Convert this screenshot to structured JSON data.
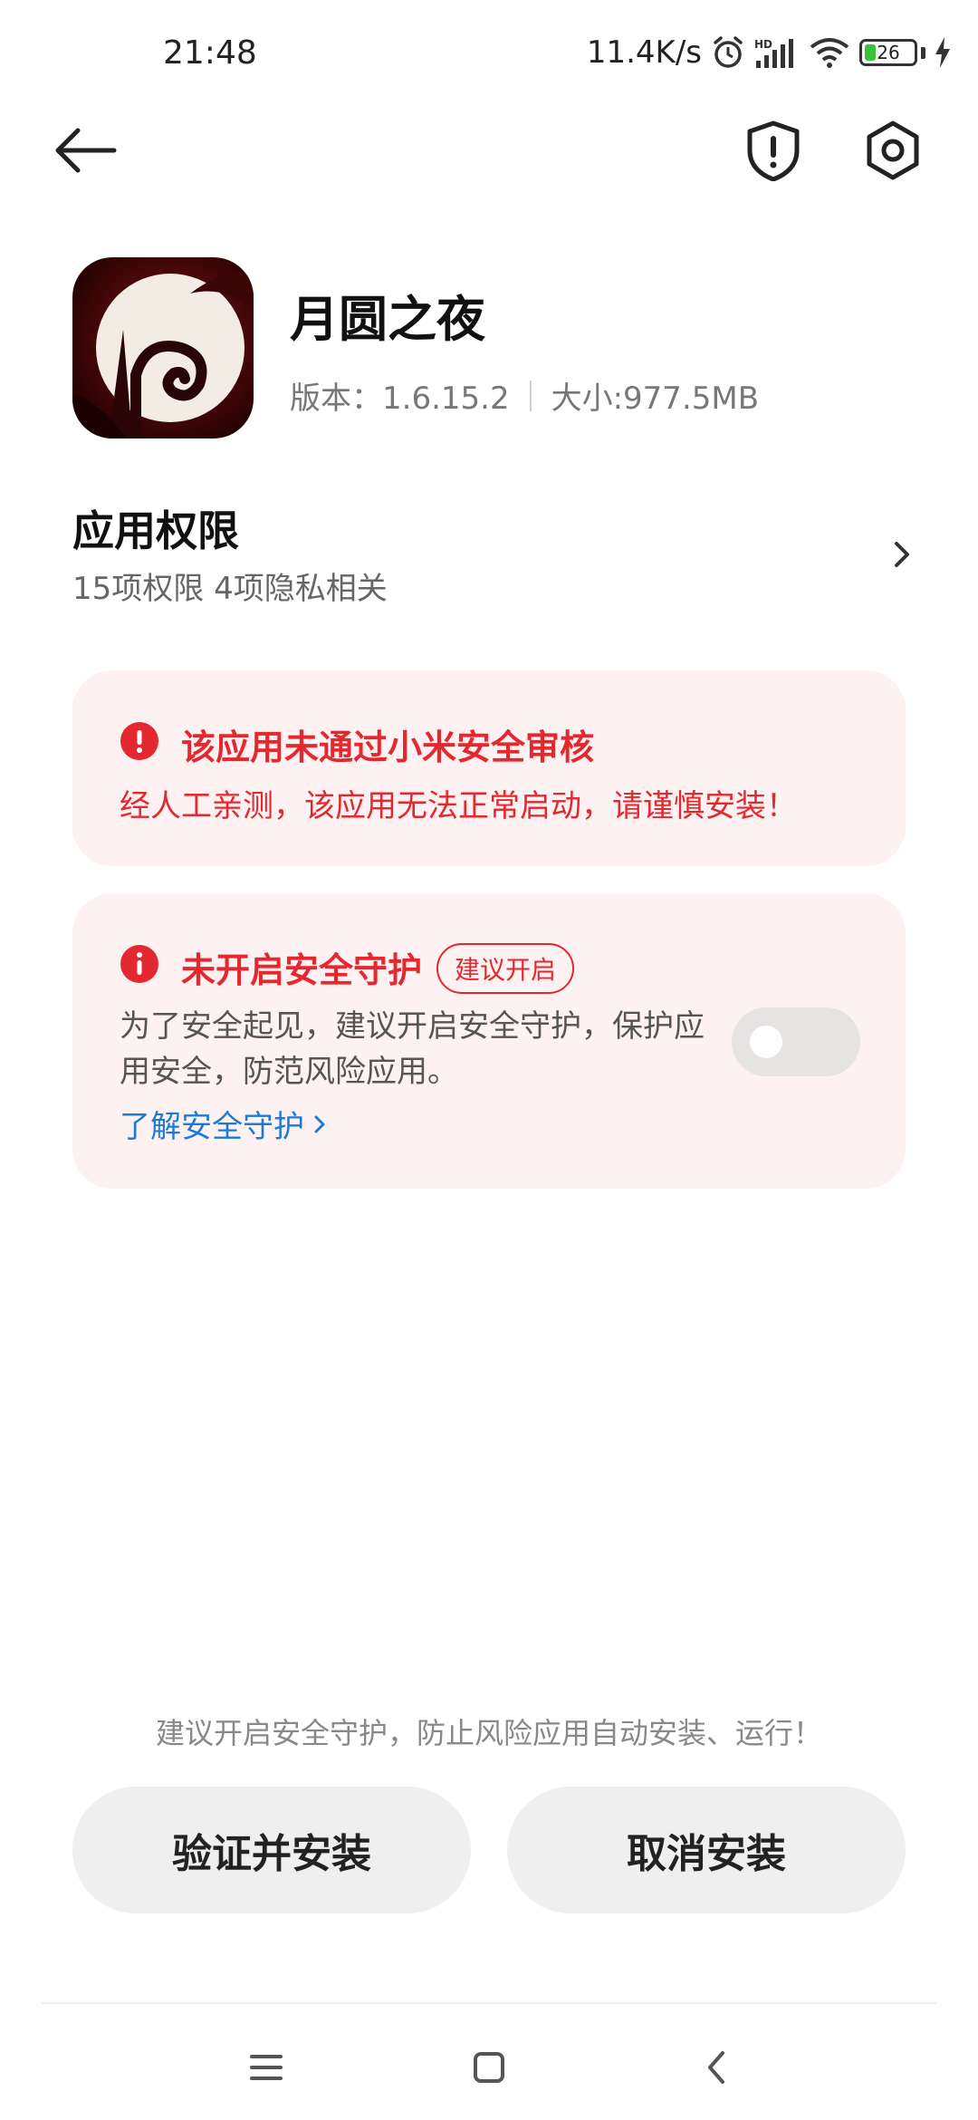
{
  "status_bar": {
    "time": "21:48",
    "net_speed": "11.4K/s",
    "battery_level": "26",
    "icons": [
      "alarm-icon",
      "hd-signal-icon",
      "wifi-icon",
      "battery-icon",
      "charging-icon"
    ]
  },
  "header": {
    "icons": [
      "back-arrow-icon",
      "shield-alert-icon",
      "settings-hex-icon"
    ]
  },
  "app": {
    "name": "月圆之夜",
    "version": "版本：1.6.15.2",
    "size": "大小:977.5MB"
  },
  "permissions": {
    "title": "应用权限",
    "subtitle": "15项权限 4项隐私相关"
  },
  "warning_card": {
    "title": "该应用未通过小米安全审核",
    "description": "经人工亲测，该应用无法正常启动，请谨慎安装！"
  },
  "protection_card": {
    "title": "未开启安全守护",
    "badge": "建议开启",
    "description": "为了安全起见，建议开启安全守护，保护应用安全，防范风险应用。",
    "link": "了解安全守护",
    "toggle_on": false
  },
  "footer": {
    "hint": "建议开启安全守护，防止风险应用自动安装、运行！",
    "verify_button": "验证并安装",
    "cancel_button": "取消安装"
  },
  "colors": {
    "danger": "#e3282f",
    "card_bg": "#fdf1f1",
    "link": "#1d7bd8",
    "button_bg": "#efefef"
  }
}
